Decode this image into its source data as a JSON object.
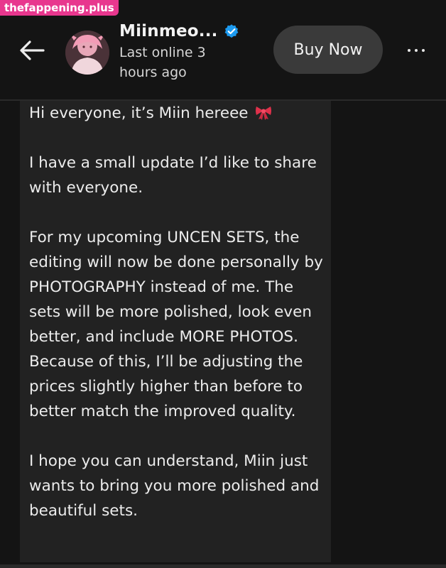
{
  "watermark": {
    "text": "thefappening.plus"
  },
  "header": {
    "back_icon": "arrow-left-icon",
    "avatar_icon": "avatar",
    "name": "Miinmeo...",
    "verified_icon": "verified-badge-icon",
    "status_line1": "Last online 3",
    "status_line2": "hours ago",
    "buy_label": "Buy Now",
    "more_icon": "more-horizontal-icon"
  },
  "message": {
    "paragraphs": [
      "Hi everyone, it’s Miin hereee",
      "I have a small update I’d like to share with everyone.",
      "For my upcoming UNCEN SETS, the editing will now be done personally by PHOTOGRAPHY instead of me. The sets will be more polished, look even better, and include MORE PHOTOS. Because of this, I’ll be adjusting the prices slightly higher than before to better match the improved quality.",
      "I hope you can understand, Miin just wants to bring you more polished and beautiful sets."
    ],
    "ribbon_icon": "ribbon-bow-icon"
  },
  "colors": {
    "background": "#141414",
    "bubble": "#222222",
    "button": "#3a3a3a",
    "verified": "#1d9bf0",
    "watermark": "#e8378e",
    "ribbon": "#e0314b"
  }
}
